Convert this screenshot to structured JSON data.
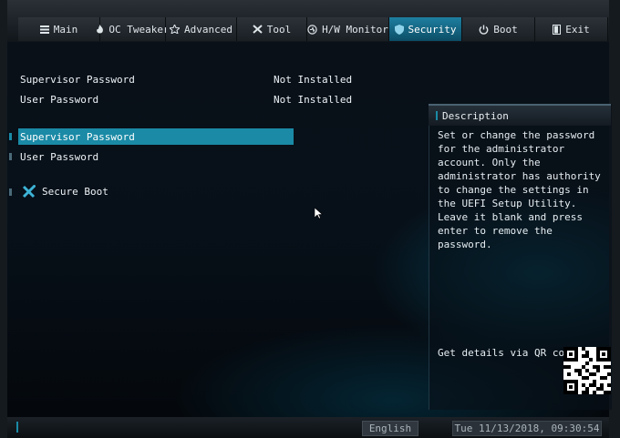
{
  "tabs": [
    {
      "label": "Main",
      "icon": "menu-icon"
    },
    {
      "label": "OC Tweaker",
      "icon": "flame-icon"
    },
    {
      "label": "Advanced",
      "icon": "star-icon"
    },
    {
      "label": "Tool",
      "icon": "tools-icon"
    },
    {
      "label": "H/W Monitor",
      "icon": "monitor-icon"
    },
    {
      "label": "Security",
      "icon": "shield-icon",
      "active": true
    },
    {
      "label": "Boot",
      "icon": "power-icon"
    },
    {
      "label": "Exit",
      "icon": "exit-icon"
    }
  ],
  "status": {
    "supervisor_label": "Supervisor Password",
    "supervisor_value": "Not Installed",
    "user_label": "User Password",
    "user_value": "Not Installed"
  },
  "menu": {
    "supervisor": "Supervisor Password",
    "user": "User Password",
    "secure_boot": "Secure Boot"
  },
  "description": {
    "title": "Description",
    "text": "Set or change the password for the administrator account. Only the administrator has authority to change the settings in the UEFI Setup Utility. Leave it blank and press enter to remove the password.",
    "qr_label": "Get details via QR code"
  },
  "footer": {
    "language": "English",
    "datetime": "Tue 11/13/2018, 09:30:54"
  },
  "colors": {
    "accent": "#1a8aa6",
    "background": "#071019"
  }
}
